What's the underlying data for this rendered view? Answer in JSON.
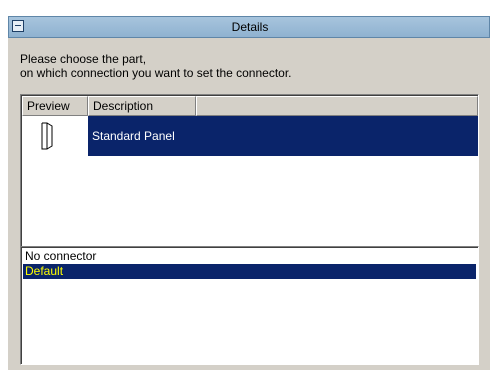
{
  "panel": {
    "title": "Details"
  },
  "instructions": {
    "line1": "Please choose the part,",
    "line2": "on which connection you want to set the connector."
  },
  "part_list": {
    "columns": [
      "Preview",
      "Description",
      ""
    ],
    "rows": [
      {
        "preview_icon": "panel-outline-icon",
        "description": "Standard Panel",
        "selected": true
      }
    ]
  },
  "connector_list": {
    "items": [
      {
        "label": "No connector",
        "selected": false
      },
      {
        "label": "Default",
        "selected": true
      }
    ]
  },
  "colors": {
    "selection_bg": "#0a246a",
    "selection_text_parts": "#ffffff",
    "selection_text_connector": "#ffff00",
    "panel_bg": "#d4d0c8",
    "titlebar_bg": "#9dbcd7"
  }
}
